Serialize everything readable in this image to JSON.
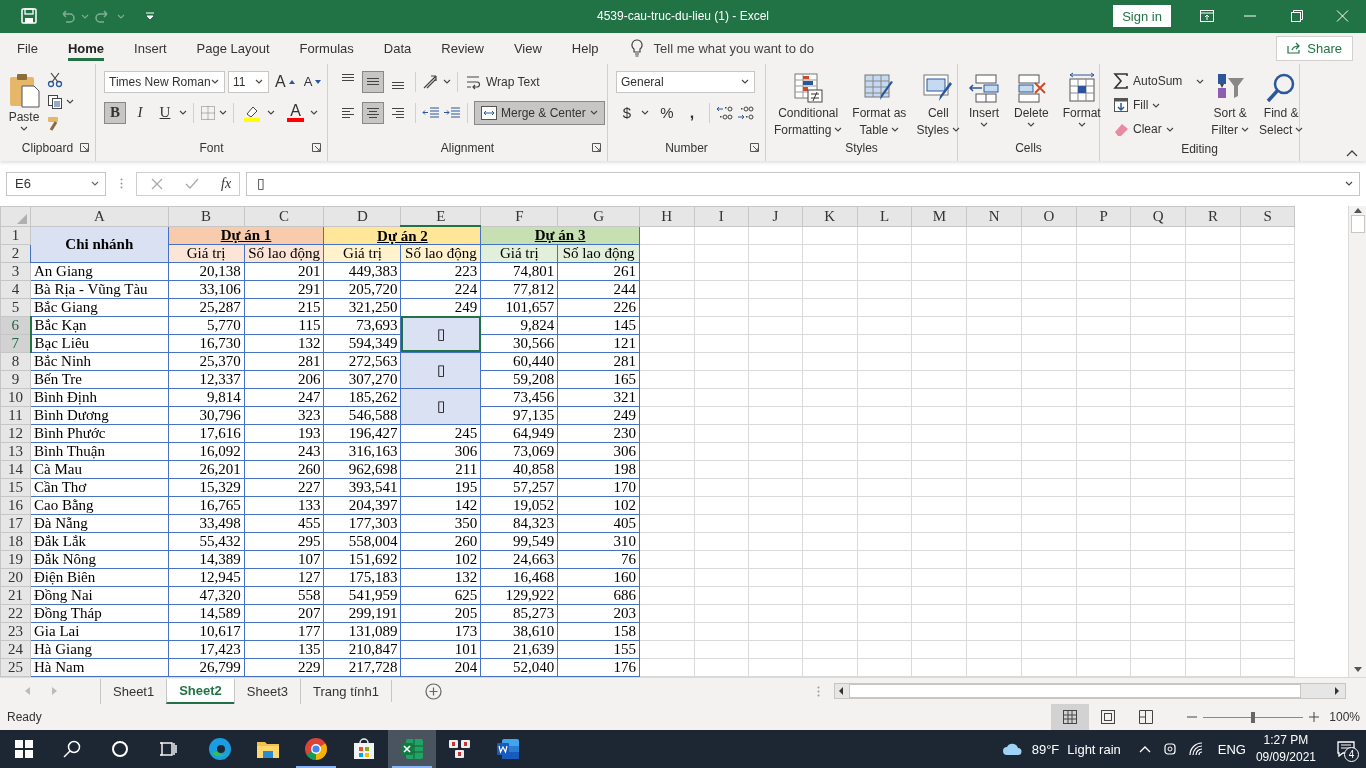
{
  "window": {
    "title": "4539-cau-truc-du-lieu (1)  -  Excel",
    "sign_in": "Sign in"
  },
  "menu_tabs": [
    {
      "label": "File",
      "selected": false
    },
    {
      "label": "Home",
      "selected": true
    },
    {
      "label": "Insert",
      "selected": false
    },
    {
      "label": "Page Layout",
      "selected": false
    },
    {
      "label": "Formulas",
      "selected": false
    },
    {
      "label": "Data",
      "selected": false
    },
    {
      "label": "Review",
      "selected": false
    },
    {
      "label": "View",
      "selected": false
    },
    {
      "label": "Help",
      "selected": false
    }
  ],
  "tell_me": "Tell me what you want to do",
  "share": "Share",
  "clipboard": {
    "paste": "Paste",
    "group": "Clipboard"
  },
  "font": {
    "name": "Times New Roman",
    "size": "11",
    "grow": "A",
    "shrink": "A",
    "styles": [
      {
        "label": "B",
        "pressed": true
      },
      {
        "label": "I",
        "pressed": false
      },
      {
        "label": "U",
        "pressed": false
      }
    ],
    "highlight": {
      "color": "#ffff00"
    },
    "font_color": {
      "glyph": "A",
      "color": "#ff0000"
    },
    "group": "Font"
  },
  "alignment": {
    "vertical": [
      {
        "kind": "top",
        "pressed": false
      },
      {
        "kind": "middle",
        "pressed": true
      },
      {
        "kind": "bottom",
        "pressed": false
      }
    ],
    "horizontal": [
      {
        "kind": "left",
        "pressed": false
      },
      {
        "kind": "center",
        "pressed": true
      },
      {
        "kind": "right",
        "pressed": false
      }
    ],
    "wrap_text": "Wrap Text",
    "merge": {
      "label": "Merge & Center",
      "pressed": true
    },
    "group": "Alignment"
  },
  "number": {
    "format": "General",
    "currency": "$",
    "percent": "%",
    "comma": ",",
    "group": "Number"
  },
  "styles": {
    "buttons": [
      {
        "kind": "conditional",
        "lines": [
          "Conditional",
          "Formatting"
        ]
      },
      {
        "kind": "table",
        "lines": [
          "Format as",
          "Table"
        ]
      },
      {
        "kind": "cell",
        "lines": [
          "Cell",
          "Styles"
        ]
      }
    ],
    "group": "Styles"
  },
  "cells": {
    "buttons": [
      {
        "kind": "insert",
        "label": "Insert"
      },
      {
        "kind": "delete",
        "label": "Delete"
      },
      {
        "kind": "format",
        "label": "Format"
      }
    ],
    "group": "Cells"
  },
  "editing": {
    "small": [
      {
        "kind": "autosum",
        "label": "AutoSum"
      },
      {
        "kind": "fill",
        "label": "Fill"
      },
      {
        "kind": "clear",
        "label": "Clear"
      }
    ],
    "big": [
      {
        "kind": "sort",
        "lines": [
          "Sort &",
          "Filter"
        ]
      },
      {
        "kind": "find",
        "lines": [
          "Find &",
          "Select"
        ]
      }
    ],
    "group": "Editing"
  },
  "formula_bar": {
    "name_box": "E6",
    "function_label": "fx",
    "content": "▯"
  },
  "sheet": {
    "columns": [
      {
        "label": "A",
        "selected": false
      },
      {
        "label": "B",
        "selected": false
      },
      {
        "label": "C",
        "selected": false
      },
      {
        "label": "D",
        "selected": false
      },
      {
        "label": "E",
        "selected": true
      },
      {
        "label": "F",
        "selected": false
      },
      {
        "label": "G",
        "selected": false
      },
      {
        "label": "H",
        "selected": false
      },
      {
        "label": "I",
        "selected": false
      },
      {
        "label": "J",
        "selected": false
      },
      {
        "label": "K",
        "selected": false
      },
      {
        "label": "L",
        "selected": false
      },
      {
        "label": "M",
        "selected": false
      },
      {
        "label": "N",
        "selected": false
      },
      {
        "label": "O",
        "selected": false
      },
      {
        "label": "P",
        "selected": false
      },
      {
        "label": "Q",
        "selected": false
      },
      {
        "label": "R",
        "selected": false
      },
      {
        "label": "S",
        "selected": false
      }
    ],
    "row_numbers": [
      {
        "label": "1",
        "selected": false
      },
      {
        "label": "2",
        "selected": false
      },
      {
        "label": "3",
        "selected": false
      },
      {
        "label": "4",
        "selected": false
      },
      {
        "label": "5",
        "selected": false
      },
      {
        "label": "6",
        "selected": true
      },
      {
        "label": "7",
        "selected": true
      },
      {
        "label": "8",
        "selected": false
      },
      {
        "label": "9",
        "selected": false
      },
      {
        "label": "10",
        "selected": false
      },
      {
        "label": "11",
        "selected": false
      },
      {
        "label": "12",
        "selected": false
      },
      {
        "label": "13",
        "selected": false
      },
      {
        "label": "14",
        "selected": false
      },
      {
        "label": "15",
        "selected": false
      },
      {
        "label": "16",
        "selected": false
      },
      {
        "label": "17",
        "selected": false
      },
      {
        "label": "18",
        "selected": false
      },
      {
        "label": "19",
        "selected": false
      },
      {
        "label": "20",
        "selected": false
      },
      {
        "label": "21",
        "selected": false
      },
      {
        "label": "22",
        "selected": false
      },
      {
        "label": "23",
        "selected": false
      },
      {
        "label": "24",
        "selected": false
      },
      {
        "label": "25",
        "selected": false
      }
    ],
    "header": {
      "label": "Chi nhánh",
      "color": "#d9e1f2",
      "groups": [
        {
          "title": "Dự án 1",
          "color": "#f8cbad",
          "subheaders": [
            {
              "label": "Giá trị",
              "color": "#fce4d6"
            },
            {
              "label": "Số lao động",
              "color": "#fce4d6"
            }
          ]
        },
        {
          "title": "Dự án 2",
          "color": "#ffe699",
          "subheaders": [
            {
              "label": "Giá trị",
              "color": "#fff2cc"
            },
            {
              "label": "Số lao động",
              "color": "#fff2cc"
            }
          ]
        },
        {
          "title": "Dự án 3",
          "color": "#c6e0b4",
          "subheaders": [
            {
              "label": "Giá trị",
              "color": "#e2efda"
            },
            {
              "label": "Số lao động",
              "color": "#e2efda"
            }
          ]
        }
      ]
    },
    "data": [
      [
        "An Giang",
        "20,138",
        "201",
        "449,383",
        "223",
        "74,801",
        "261"
      ],
      [
        "Bà Rịa - Vũng Tàu",
        "33,106",
        "291",
        "205,720",
        "224",
        "77,812",
        "244"
      ],
      [
        "Bắc Giang",
        "25,287",
        "215",
        "321,250",
        "249",
        "101,657",
        "226"
      ],
      [
        "Bắc Kạn",
        "5,770",
        "115",
        "73,693",
        {
          "text": "▯",
          "rowspan": 2,
          "color": "#d9e1f2",
          "selected": true
        },
        "9,824",
        "145"
      ],
      [
        "Bạc Liêu",
        "16,730",
        "132",
        "594,349",
        "30,566",
        "121"
      ],
      [
        "Bắc Ninh",
        "25,370",
        "281",
        "272,563",
        {
          "text": "▯",
          "rowspan": 2,
          "color": "#d9e1f2",
          "selected": false
        },
        "60,440",
        "281"
      ],
      [
        "Bến Tre",
        "12,337",
        "206",
        "307,270",
        "59,208",
        "165"
      ],
      [
        "Bình Định",
        "9,814",
        "247",
        "185,262",
        {
          "text": "▯",
          "rowspan": 2,
          "color": "#d9e1f2",
          "selected": false
        },
        "73,456",
        "321"
      ],
      [
        "Bình Dương",
        "30,796",
        "323",
        "546,588",
        "97,135",
        "249"
      ],
      [
        "Bình Phước",
        "17,616",
        "193",
        "196,427",
        "245",
        "64,949",
        "230"
      ],
      [
        "Bình Thuận",
        "16,092",
        "243",
        "316,163",
        "306",
        "73,069",
        "306"
      ],
      [
        "Cà Mau",
        "26,201",
        "260",
        "962,698",
        "211",
        "40,858",
        "198"
      ],
      [
        "Cần Thơ",
        "15,329",
        "227",
        "393,541",
        "195",
        "57,257",
        "170"
      ],
      [
        "Cao Bằng",
        "16,765",
        "133",
        "204,397",
        "142",
        "19,052",
        "102"
      ],
      [
        "Đà Nẵng",
        "33,498",
        "455",
        "177,303",
        "350",
        "84,323",
        "405"
      ],
      [
        "Đắk Lắk",
        "55,432",
        "295",
        "558,004",
        "260",
        "99,549",
        "310"
      ],
      [
        "Đắk Nông",
        "14,389",
        "107",
        "151,692",
        "102",
        "24,663",
        "76"
      ],
      [
        "Điện Biên",
        "12,945",
        "127",
        "175,183",
        "132",
        "16,468",
        "160"
      ],
      [
        "Đồng Nai",
        "47,320",
        "558",
        "541,959",
        "625",
        "129,922",
        "686"
      ],
      [
        "Đồng Tháp",
        "14,589",
        "207",
        "299,191",
        "205",
        "85,273",
        "203"
      ],
      [
        "Gia Lai",
        "10,617",
        "177",
        "131,089",
        "173",
        "38,610",
        "158"
      ],
      [
        "Hà Giang",
        "17,423",
        "135",
        "210,847",
        "101",
        "21,639",
        "155"
      ],
      [
        "Hà Nam",
        "26,799",
        "229",
        "217,728",
        "204",
        "52,040",
        "176"
      ]
    ]
  },
  "sheet_tabs": [
    {
      "label": "Sheet1",
      "selected": false
    },
    {
      "label": "Sheet2",
      "selected": true
    },
    {
      "label": "Sheet3",
      "selected": false
    },
    {
      "label": "Trang tính1",
      "selected": false
    }
  ],
  "status_bar": {
    "status": "Ready",
    "views": [
      {
        "kind": "normal",
        "selected": true
      },
      {
        "kind": "page_layout",
        "selected": false
      },
      {
        "kind": "page_break",
        "selected": false
      }
    ],
    "zoom": {
      "level": 0.5,
      "label": "100%"
    }
  },
  "taskbar": {
    "buttons": [
      {
        "kind": "start"
      },
      {
        "kind": "search"
      },
      {
        "kind": "cortana"
      },
      {
        "kind": "task_view"
      },
      {
        "kind": "edge",
        "active": false,
        "running": false
      },
      {
        "kind": "explorer",
        "active": false,
        "running": false
      },
      {
        "kind": "chrome",
        "active": false,
        "running": true
      },
      {
        "kind": "store",
        "active": false,
        "running": false
      },
      {
        "kind": "excel",
        "active": true,
        "running": true
      },
      {
        "kind": "unikey",
        "active": false,
        "running": false
      },
      {
        "kind": "word",
        "active": false,
        "running": false
      }
    ],
    "weather": {
      "temperature": "89°F",
      "condition": "Light rain"
    },
    "language": "ENG",
    "time": "1:27 PM",
    "date": "09/09/2021",
    "notifications": "4"
  }
}
